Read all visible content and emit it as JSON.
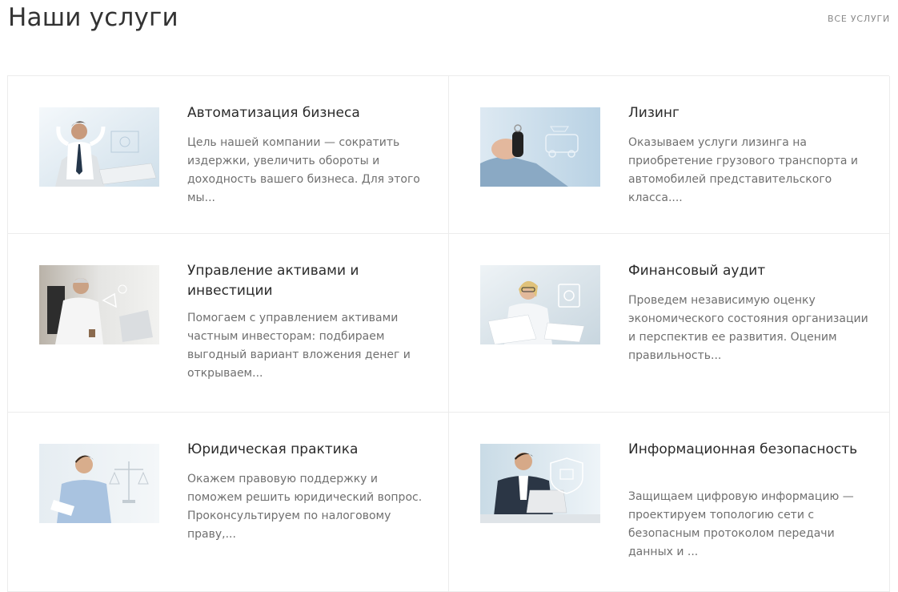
{
  "header": {
    "title": "Наши услуги",
    "all_link": "ВСЕ УСЛУГИ"
  },
  "services": [
    {
      "title": "Автоматизация бизнеса",
      "description": "Цель нашей компании — сократить издержки, увеличить обороты и доходность вашего бизнеса. Для этого мы...",
      "image": "businessman-automation-photo"
    },
    {
      "title": "Лизинг",
      "description": "Оказываем услуги лизинга на приобретение грузового транспорта и автомобилей представительского класса....",
      "image": "car-key-leasing-photo"
    },
    {
      "title": "Управление активами и инвестиции",
      "description": "Помогаем с управлением активами частным инвесторам: подбираем выгодный вариант вложения денег и открываем...",
      "image": "investor-laptop-photo"
    },
    {
      "title": "Финансовый аудит",
      "description": "Проведем независимую оценку экономического состояния организации и перспектив ее развития. Оценим правильность...",
      "image": "auditor-documents-photo"
    },
    {
      "title": "Юридическая практика",
      "description": "Окажем правовую поддержку и поможем решить юридический вопрос. Проконсультируем по налоговому праву,...",
      "image": "lawyer-scales-photo"
    },
    {
      "title": "Информационная безопасность",
      "description": "Защищаем цифровую информацию — проектируем топологию сети с безопасным протоколом передачи данных и ...",
      "image": "security-laptop-photo"
    }
  ]
}
